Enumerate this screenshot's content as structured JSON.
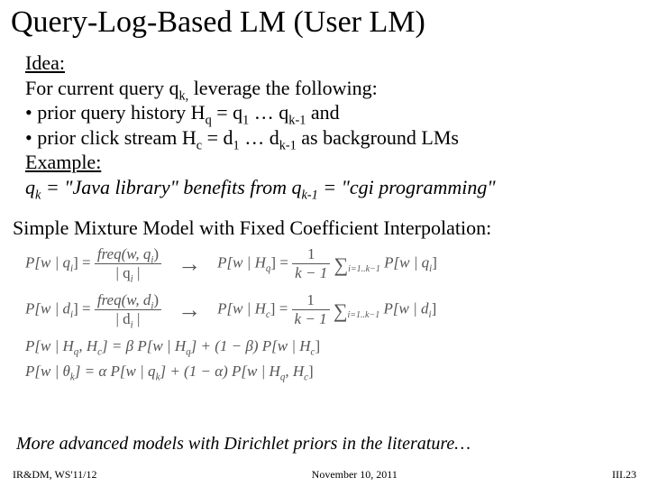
{
  "title": "Query-Log-Based LM (User LM)",
  "idea": {
    "heading": "Idea:",
    "line1_a": "For current query q",
    "line1_sub": "k,",
    "line1_b": " leverage the following:",
    "bullet1_a": "• prior query history H",
    "bullet1_sub1": "q",
    "bullet1_b": " = q",
    "bullet1_sub2": "1",
    "bullet1_c": " … q",
    "bullet1_sub3": "k-1",
    "bullet1_d": " and",
    "bullet2_a": "• prior click stream   H",
    "bullet2_sub1": "c",
    "bullet2_b": " = d",
    "bullet2_sub2": "1",
    "bullet2_c": " … d",
    "bullet2_sub3": "k-1",
    "bullet2_d": " as background LMs",
    "example_heading": "Example:",
    "example_a": "q",
    "example_sub1": "k",
    "example_b": " = \"Java library\" benefits from q",
    "example_sub2": "k-1",
    "example_c": " = \"cgi programming\""
  },
  "mixtext": "Simple Mixture Model with Fixed Coefficient Interpolation:",
  "eq": {
    "r1_lhs": "P[w | q",
    "r1_lhs_sub": "i",
    "r1_lhs_end": "] = ",
    "r1_num_a": "freq(w, q",
    "r1_num_sub": "i",
    "r1_num_b": ")",
    "r1_den_a": "| q",
    "r1_den_sub": "i",
    "r1_den_b": " |",
    "r1_rhs_a": "P[w | H",
    "r1_rhs_sub": "q",
    "r1_rhs_b": "] = ",
    "r1_frac2_num": "1",
    "r1_frac2_den": "k − 1",
    "r1_sumsub": "i=1..k−1",
    "r1_tail_a": " P[w | q",
    "r1_tail_sub": "i",
    "r1_tail_b": "]",
    "r2_lhs": "P[w | d",
    "r2_num_a": "freq(w, d",
    "r2_den_a": "| d",
    "r2_rhs_a": "P[w | H",
    "r2_rhs_sub": "c",
    "r2_tail_a": " P[w | d",
    "eq3_a": "P[w | H",
    "eq3_sub1": "q",
    "eq3_b": ", H",
    "eq3_sub2": "c",
    "eq3_c": "] = β P[w | H",
    "eq3_sub3": "q",
    "eq3_d": "] + (1 − β) P[w | H",
    "eq3_sub4": "c",
    "eq3_e": "]",
    "eq4_a": "P[w | θ",
    "eq4_sub1": "k",
    "eq4_b": "] = α P[w | q",
    "eq4_sub2": "k",
    "eq4_c": "] + (1 − α) P[w | H",
    "eq4_sub3": "q",
    "eq4_d": ", H",
    "eq4_sub4": "c",
    "eq4_e": "]"
  },
  "advanced": "More advanced models with Dirichlet priors in the literature…",
  "footer": {
    "left": "IR&DM, WS'11/12",
    "center": "November 10, 2011",
    "right": "III.23"
  }
}
